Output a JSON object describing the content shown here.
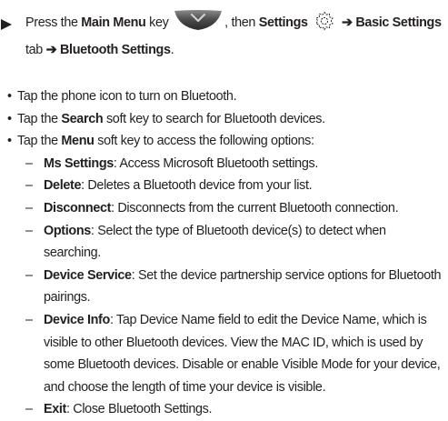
{
  "step": {
    "press": "Press the",
    "main_menu": "Main Menu",
    "key_then": " key",
    "then": ", then",
    "settings": "Settings",
    "arrow1": "➔",
    "basic_settings": "Basic Settings",
    "tab": "tab",
    "arrow2": "➔",
    "bluetooth_settings": "Bluetooth Settings",
    "period": "."
  },
  "bullets": [
    {
      "text": "Tap the phone icon to turn on Bluetooth."
    },
    {
      "pre": "Tap the ",
      "bold": "Search",
      "post": " soft key to search for Bluetooth devices."
    },
    {
      "pre": "Tap the ",
      "bold": "Menu",
      "post": " soft key to access the following options:"
    }
  ],
  "options": [
    {
      "term": "Ms Settings",
      "desc": ": Access Microsoft Bluetooth settings."
    },
    {
      "term": "Delete",
      "desc": ": Deletes a Bluetooth device from your list."
    },
    {
      "term": "Disconnect",
      "desc": ": Disconnects from the current Bluetooth connection."
    },
    {
      "term": "Options",
      "desc": ": Select the type of Bluetooth device(s) to detect when searching."
    },
    {
      "term": "Device Service",
      "desc": ": Set the device partnership service options for Bluetooth pairings."
    },
    {
      "term": "Device Info",
      "desc": ": Tap Device Name field to edit the Device Name, which is visible to other Bluetooth devices.  View the MAC ID, which is used by some Bluetooth devices.  Disable or enable Visible Mode for your device, and choose the length of time your device is visible."
    },
    {
      "term": "Exit",
      "desc": ": Close Bluetooth Settings."
    }
  ],
  "icons": {
    "main_menu_key": "main-menu-key-icon",
    "settings": "gear-icon"
  }
}
